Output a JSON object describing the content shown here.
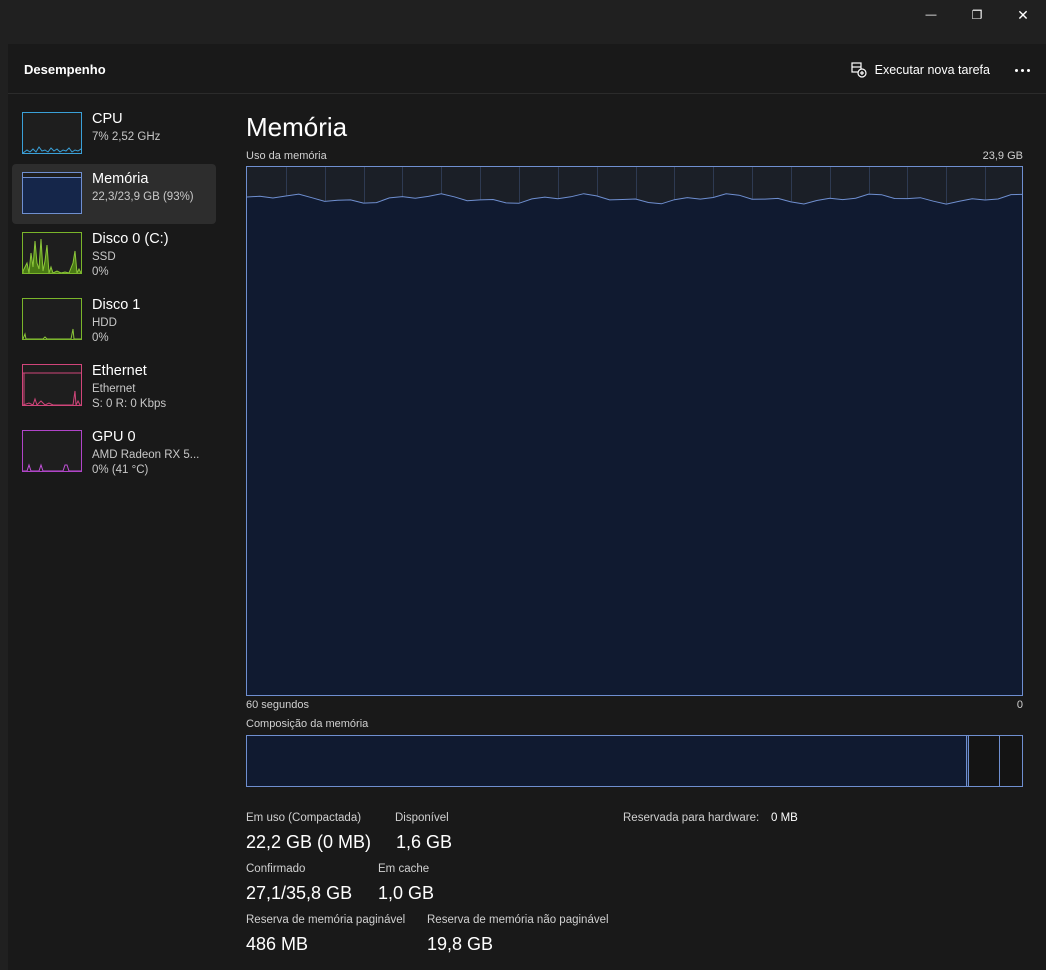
{
  "window": {
    "buttons": [
      {
        "name": "minimize",
        "glyph": "—"
      },
      {
        "name": "restore",
        "glyph": "❐"
      },
      {
        "name": "close",
        "glyph": "✕"
      }
    ]
  },
  "header": {
    "title": "Desempenho",
    "run_task_label": "Executar nova tarefa",
    "more_icon": "more-icon"
  },
  "sidebar": {
    "items": [
      {
        "name": "CPU",
        "line1": "7% 2,52 GHz",
        "line2": "",
        "color": "#3aa0d8",
        "selected": false
      },
      {
        "name": "Memória",
        "line1": "22,3/23,9 GB (93%)",
        "line2": "",
        "color": "#6f8fd0",
        "selected": true
      },
      {
        "name": "Disco 0 (C:)",
        "line1": "SSD",
        "line2": "0%",
        "color": "#7ab52a",
        "selected": false
      },
      {
        "name": "Disco 1",
        "line1": "HDD",
        "line2": "0%",
        "color": "#7ab52a",
        "selected": false
      },
      {
        "name": "Ethernet",
        "line1": "Ethernet",
        "line2": "S: 0 R: 0 Kbps",
        "color": "#d0457a",
        "selected": false
      },
      {
        "name": "GPU 0",
        "line1": "AMD Radeon RX 5...",
        "line2": "0% (41 °C)",
        "color": "#b044c8",
        "selected": false
      }
    ]
  },
  "memory": {
    "title": "Memória",
    "usage_label": "Uso da memória",
    "usage_max": "23,9 GB",
    "x_left": "60 segundos",
    "x_right": "0",
    "composition_label": "Composição da memória",
    "usage_fraction": 0.93,
    "composition": {
      "in_use_fraction": 0.929,
      "modified_fraction": 0.003,
      "standby_fraction": 0.04,
      "free_fraction": 0.028
    },
    "stats": {
      "in_use_label": "Em uso (Compactada)",
      "in_use_value": "22,2 GB (0 MB)",
      "available_label": "Disponível",
      "available_value": "1,6 GB",
      "hw_reserved_label": "Reservada para hardware:",
      "hw_reserved_value": "0 MB",
      "committed_label": "Confirmado",
      "committed_value": "27,1/35,8 GB",
      "cached_label": "Em cache",
      "cached_value": "1,0 GB",
      "paged_label": "Reserva de memória paginável",
      "paged_value": "486 MB",
      "nonpaged_label": "Reserva de memória não paginável",
      "nonpaged_value": "19,8 GB"
    }
  },
  "colors": {
    "memory_accent": "#6f8fd0",
    "memory_fill": "#101a30"
  }
}
